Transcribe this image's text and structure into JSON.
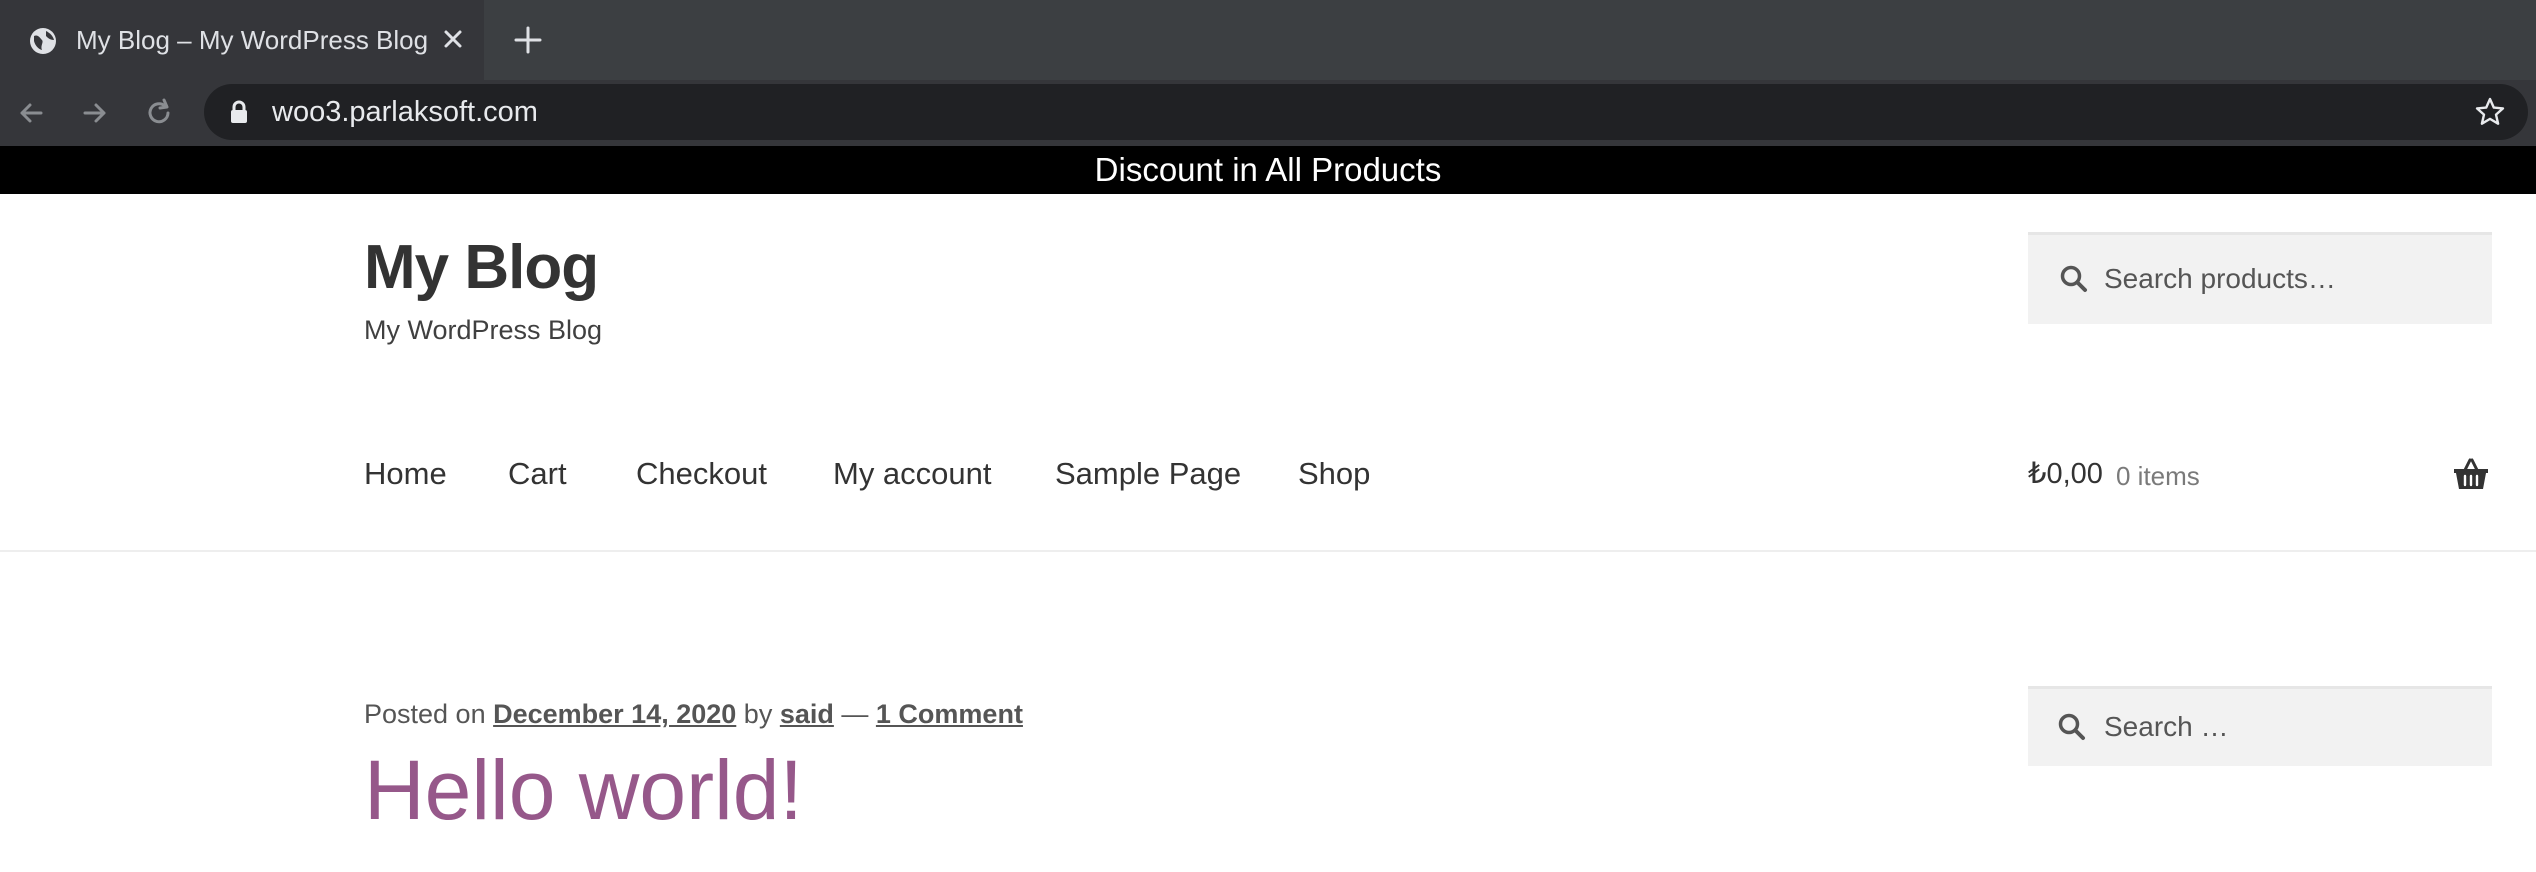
{
  "browser": {
    "tab_title": "My Blog – My WordPress Blog",
    "url": "woo3.parlaksoft.com",
    "icons": {
      "favicon": "globe-icon",
      "close": "close-icon",
      "new_tab": "plus-icon",
      "back": "arrow-left-icon",
      "forward": "arrow-right-icon",
      "reload": "reload-icon",
      "lock": "lock-icon",
      "bookmark": "star-icon"
    }
  },
  "promo": {
    "text": "Discount in All Products"
  },
  "site": {
    "title": "My Blog",
    "description": "My WordPress Blog"
  },
  "header_search": {
    "placeholder": "Search products…"
  },
  "nav": {
    "items": [
      {
        "label": "Home"
      },
      {
        "label": "Cart"
      },
      {
        "label": "Checkout"
      },
      {
        "label": "My account"
      },
      {
        "label": "Sample Page"
      },
      {
        "label": "Shop"
      }
    ]
  },
  "cart": {
    "amount": "₺0,00",
    "count": "0 items"
  },
  "post": {
    "posted_on_label": "Posted on",
    "date": "December 14, 2020",
    "by_label": "by",
    "author": "said",
    "separator": "—",
    "comments": "1 Comment",
    "title": "Hello world!"
  },
  "sidebar_search": {
    "placeholder": "Search …"
  },
  "colors": {
    "accent": "#96588a",
    "promo_bg": "#000000",
    "chrome_bg": "#35363a"
  }
}
